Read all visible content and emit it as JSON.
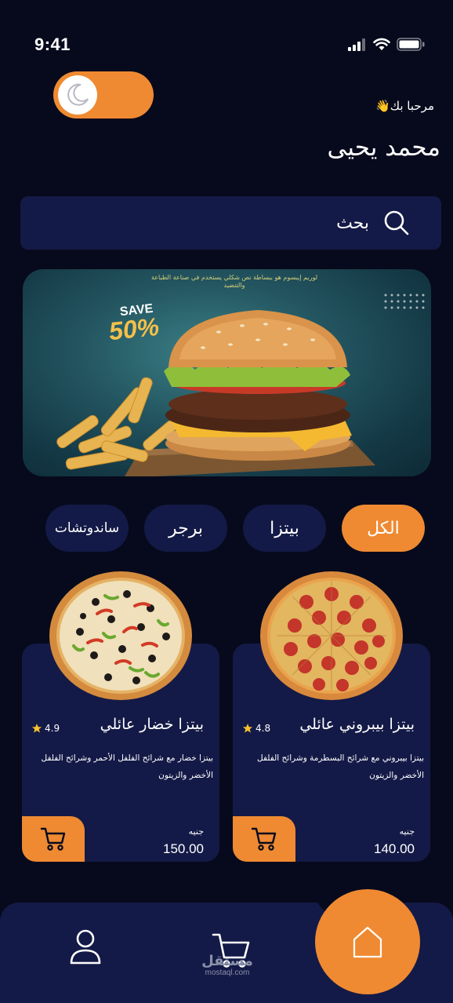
{
  "status_bar": {
    "time": "9:41"
  },
  "header": {
    "greeting": "مرحبا بك👋",
    "user_name": "محمد يحيى"
  },
  "search": {
    "placeholder": "بحث"
  },
  "promo": {
    "save_label": "SAVE",
    "save_value": "50%",
    "fine_print": "لوريم إيبسوم هو ببساطة نص شكلي يستخدم في صناعة الطباعة والتنضيد"
  },
  "categories": [
    {
      "label": "الكل",
      "active": true
    },
    {
      "label": "بيتزا",
      "active": false
    },
    {
      "label": "برجر",
      "active": false
    },
    {
      "label": "ساندوتشات",
      "active": false
    }
  ],
  "products": [
    {
      "title": "بيتزا بيبروني عائلي",
      "rating": "4.8",
      "description": "بيتزا بيبروني مع شرائح البسطرمة وشرائح الفلفل الأخضر والزيتون",
      "currency": "جنيه",
      "price": "140.00"
    },
    {
      "title": "بيتزا خضار عائلي",
      "rating": "4.9",
      "description": "بيتزا خضار مع شرائح الفلفل الأحمر وشرائح الفلفل الأخضر والزيتون",
      "currency": "جنيه",
      "price": "150.00"
    }
  ],
  "watermark": {
    "brand": "مستقل",
    "url": "mostaql.com"
  },
  "colors": {
    "background": "#070a1c",
    "surface": "#141a47",
    "accent": "#ef8a32",
    "star": "#f5c12e"
  },
  "icons": {
    "toggle": "moon-icon",
    "search": "search-icon",
    "cart": "cart-icon",
    "home": "home-icon",
    "profile": "user-icon"
  }
}
